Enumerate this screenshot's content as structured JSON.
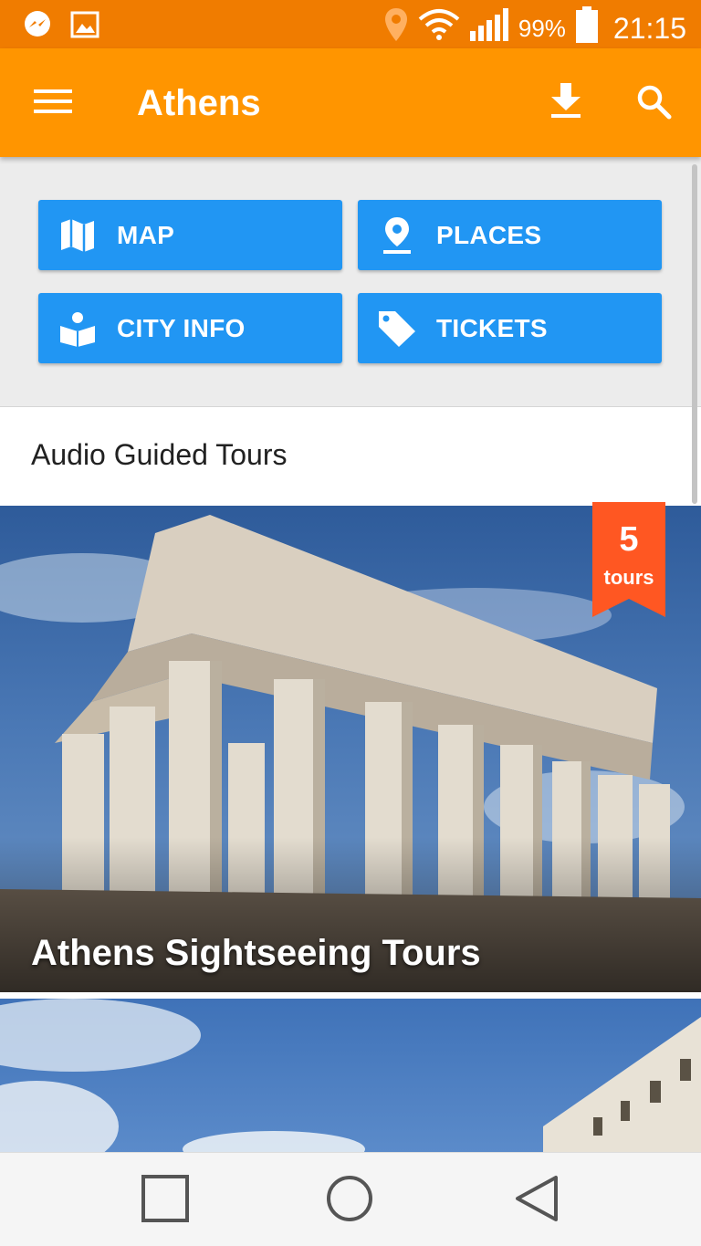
{
  "status_bar": {
    "left_icons": [
      "messenger-icon",
      "image-icon"
    ],
    "right_icons": [
      "location-icon",
      "wifi-icon",
      "signal-icon",
      "battery-icon"
    ],
    "battery_percent": "99%",
    "time": "21:15"
  },
  "app_bar": {
    "title": "Athens",
    "icons": [
      "menu-icon",
      "download-icon",
      "search-icon"
    ],
    "color": "#ff9500"
  },
  "quick_actions": [
    {
      "label": "MAP",
      "icon": "map-icon"
    },
    {
      "label": "PLACES",
      "icon": "place-pin-icon"
    },
    {
      "label": "CITY INFO",
      "icon": "city-info-icon"
    },
    {
      "label": "TICKETS",
      "icon": "ticket-tag-icon"
    }
  ],
  "section": {
    "title": "Audio Guided Tours"
  },
  "tour_cards": [
    {
      "title": "Athens Sightseeing Tours",
      "badge_count": "5",
      "badge_unit": "tours",
      "badge_color": "#ff5722",
      "image": "parthenon-photo"
    },
    {
      "title": "",
      "image": "athens-parliament-photo"
    }
  ],
  "nav_bar": {
    "icons": [
      "recent-apps-icon",
      "home-icon",
      "back-icon"
    ]
  }
}
